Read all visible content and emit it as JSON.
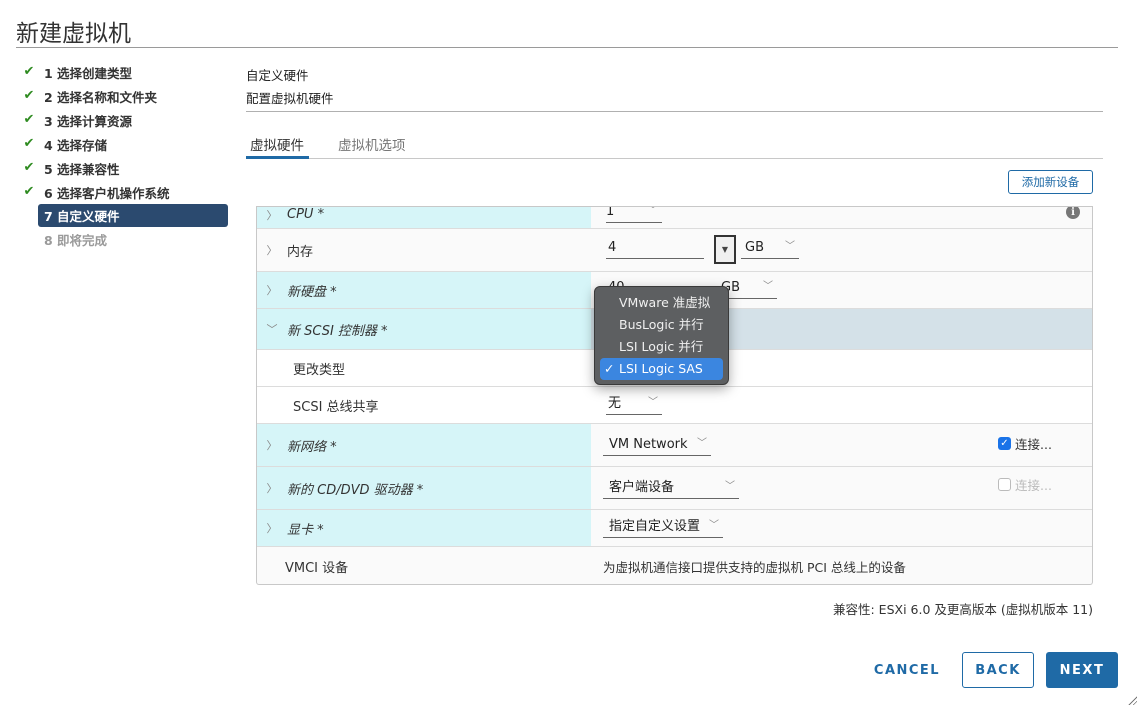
{
  "window_title": "新建虚拟机",
  "steps": [
    {
      "label": "1 选择创建类型",
      "status": "done"
    },
    {
      "label": "2 选择名称和文件夹",
      "status": "done"
    },
    {
      "label": "3 选择计算资源",
      "status": "done"
    },
    {
      "label": "4 选择存储",
      "status": "done"
    },
    {
      "label": "5 选择兼容性",
      "status": "done"
    },
    {
      "label": "6 选择客户机操作系统",
      "status": "done"
    },
    {
      "label": "7 自定义硬件",
      "status": "current"
    },
    {
      "label": "8 即将完成",
      "status": "pending"
    }
  ],
  "icons": {
    "check": "✔",
    "chevron_right": "〉",
    "chevron_down": "﹀",
    "info": "i",
    "tick": "✓",
    "spin_down": "▼"
  },
  "header": {
    "title": "自定义硬件",
    "subtitle": "配置虚拟机硬件"
  },
  "tabs": [
    {
      "label": "虚拟硬件",
      "active": true
    },
    {
      "label": "虚拟机选项",
      "active": false
    }
  ],
  "add_device_button": "添加新设备",
  "hardware": {
    "cpu": {
      "label": "CPU *",
      "value": "1"
    },
    "memory": {
      "label": "内存",
      "value": "4",
      "unit": "GB"
    },
    "hard_disk": {
      "label": "新硬盘 *",
      "value": "40",
      "unit": "GB"
    },
    "scsi": {
      "label": "新 SCSI 控制器 *",
      "change_type_label": "更改类型",
      "bus_sharing_label": "SCSI 总线共享",
      "bus_sharing_value": "无"
    },
    "network": {
      "label": "新网络 *",
      "value": "VM Network",
      "connect_label": "连接...",
      "connected": true
    },
    "cd_dvd": {
      "label": "新的 CD/DVD 驱动器 *",
      "value": "客户端设备",
      "connect_label": "连接...",
      "connected": false
    },
    "video": {
      "label": "显卡 *",
      "value": "指定自定义设置"
    },
    "vmci": {
      "label": "VMCI 设备",
      "description": "为虚拟机通信接口提供支持的虚拟机 PCI 总线上的设备"
    }
  },
  "scsi_type_dropdown": {
    "options": [
      "VMware 准虚拟",
      "BusLogic 并行",
      "LSI Logic 并行",
      "LSI Logic SAS"
    ],
    "selected": "LSI Logic SAS"
  },
  "compatibility": "兼容性: ESXi 6.0 及更高版本 (虚拟机版本 11)",
  "buttons": {
    "cancel": "CANCEL",
    "back": "BACK",
    "next": "NEXT"
  },
  "colors": {
    "accent": "#1f6aa6",
    "current_step": "#2b4a6f",
    "check": "#2e8b20",
    "row_highlight": "#d6f5f8",
    "dropdown_selected": "#3b86e0"
  }
}
